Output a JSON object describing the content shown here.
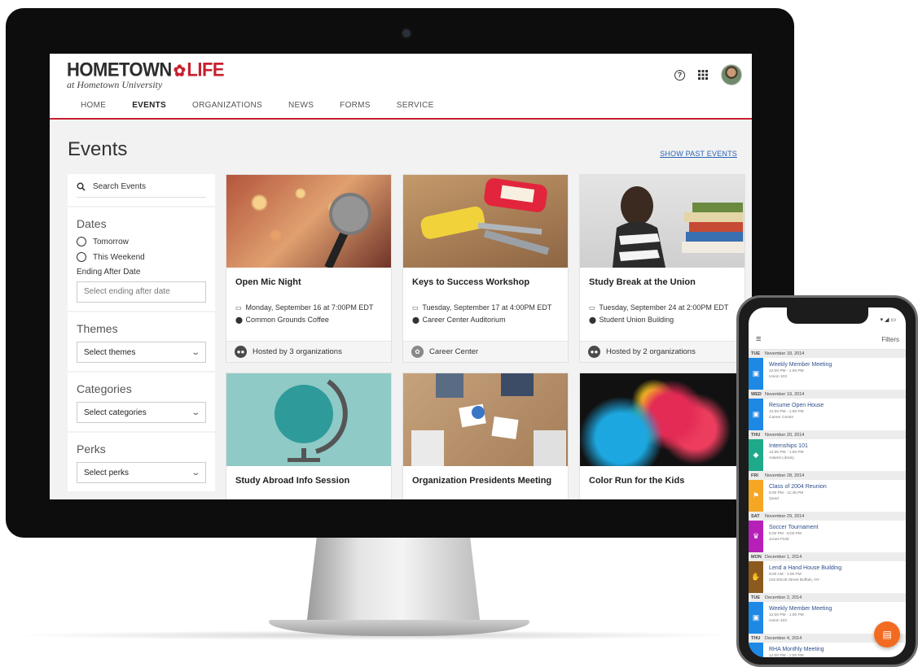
{
  "brand": {
    "name_left": "HOMETOWN",
    "name_right": "LIFE",
    "subtitle": "at Hometown University",
    "accent": "#c8202f"
  },
  "nav": {
    "items": [
      "HOME",
      "EVENTS",
      "ORGANIZATIONS",
      "NEWS",
      "FORMS",
      "SERVICE"
    ],
    "active": "EVENTS"
  },
  "header_icons": [
    "help-icon",
    "apps-grid-icon",
    "avatar"
  ],
  "page": {
    "title": "Events",
    "past_link": "SHOW PAST EVENTS"
  },
  "sidebar": {
    "search_placeholder": "Search Events",
    "dates": {
      "heading": "Dates",
      "options": [
        "Tomorrow",
        "This Weekend"
      ],
      "ending_label": "Ending After Date",
      "ending_placeholder": "Select ending after date"
    },
    "themes": {
      "heading": "Themes",
      "select": "Select themes"
    },
    "categories": {
      "heading": "Categories",
      "select": "Select categories"
    },
    "perks": {
      "heading": "Perks",
      "select": "Select perks"
    }
  },
  "events": [
    {
      "title": "Open Mic Night",
      "date": "Monday, September 16 at 7:00PM EDT",
      "location": "Common Grounds Coffee",
      "host": "Hosted by 3 organizations"
    },
    {
      "title": "Keys to Success Workshop",
      "date": "Tuesday, September 17 at 4:00PM EDT",
      "location": "Career Center Auditorium",
      "host": "Career Center"
    },
    {
      "title": "Study Break at the Union",
      "date": "Tuesday, September 24 at 2:00PM EDT",
      "location": "Student Union Building",
      "host": "Hosted by 2 organizations"
    },
    {
      "title": "Study Abroad Info Session"
    },
    {
      "title": "Organization Presidents Meeting"
    },
    {
      "title": "Color Run for the Kids"
    }
  ],
  "phone": {
    "filters_label": "Filters",
    "days": [
      {
        "dow": "TUE",
        "date": "November 18, 2014",
        "event": "Weekly Member Meeting",
        "time": "12:00 PM - 1:00 PM",
        "place": "Union 103",
        "color": "#1e88e5"
      },
      {
        "dow": "WED",
        "date": "November 19, 2014",
        "event": "Resume Open House",
        "time": "12:00 PM - 1:00 PM",
        "place": "Career Center",
        "color": "#1e88e5"
      },
      {
        "dow": "THU",
        "date": "November 20, 2014",
        "event": "Internships 101",
        "time": "12:00 PM - 1:00 PM",
        "place": "Adams Library",
        "color": "#1eaa8a"
      },
      {
        "dow": "FRI",
        "date": "November 28, 2014",
        "event": "Class of 2004 Reunion",
        "time": "6:00 PM - 11:45 PM",
        "place": "Quad",
        "color": "#f5a623"
      },
      {
        "dow": "SAT",
        "date": "November 29, 2014",
        "event": "Soccer Tournament",
        "time": "5:00 PM - 8:00 PM",
        "place": "Jones Field",
        "color": "#b620b8"
      },
      {
        "dow": "MON",
        "date": "December 1, 2014",
        "event": "Lend a Hand House Building",
        "time": "9:00 AM - 1:00 PM",
        "place": "216 Elicott Street Buffalo, NY",
        "color": "#8b5a1e"
      },
      {
        "dow": "TUE",
        "date": "December 2, 2014",
        "event": "Weekly Member Meeting",
        "time": "12:00 PM - 1:00 PM",
        "place": "Union 103",
        "color": "#1e88e5"
      },
      {
        "dow": "THU",
        "date": "December 4, 2014",
        "event": "RHA Monthly Meeting",
        "time": "12:00 PM - 1:00 PM",
        "place": "",
        "color": "#1e88e5"
      }
    ],
    "fab_color": "#f26b21"
  }
}
